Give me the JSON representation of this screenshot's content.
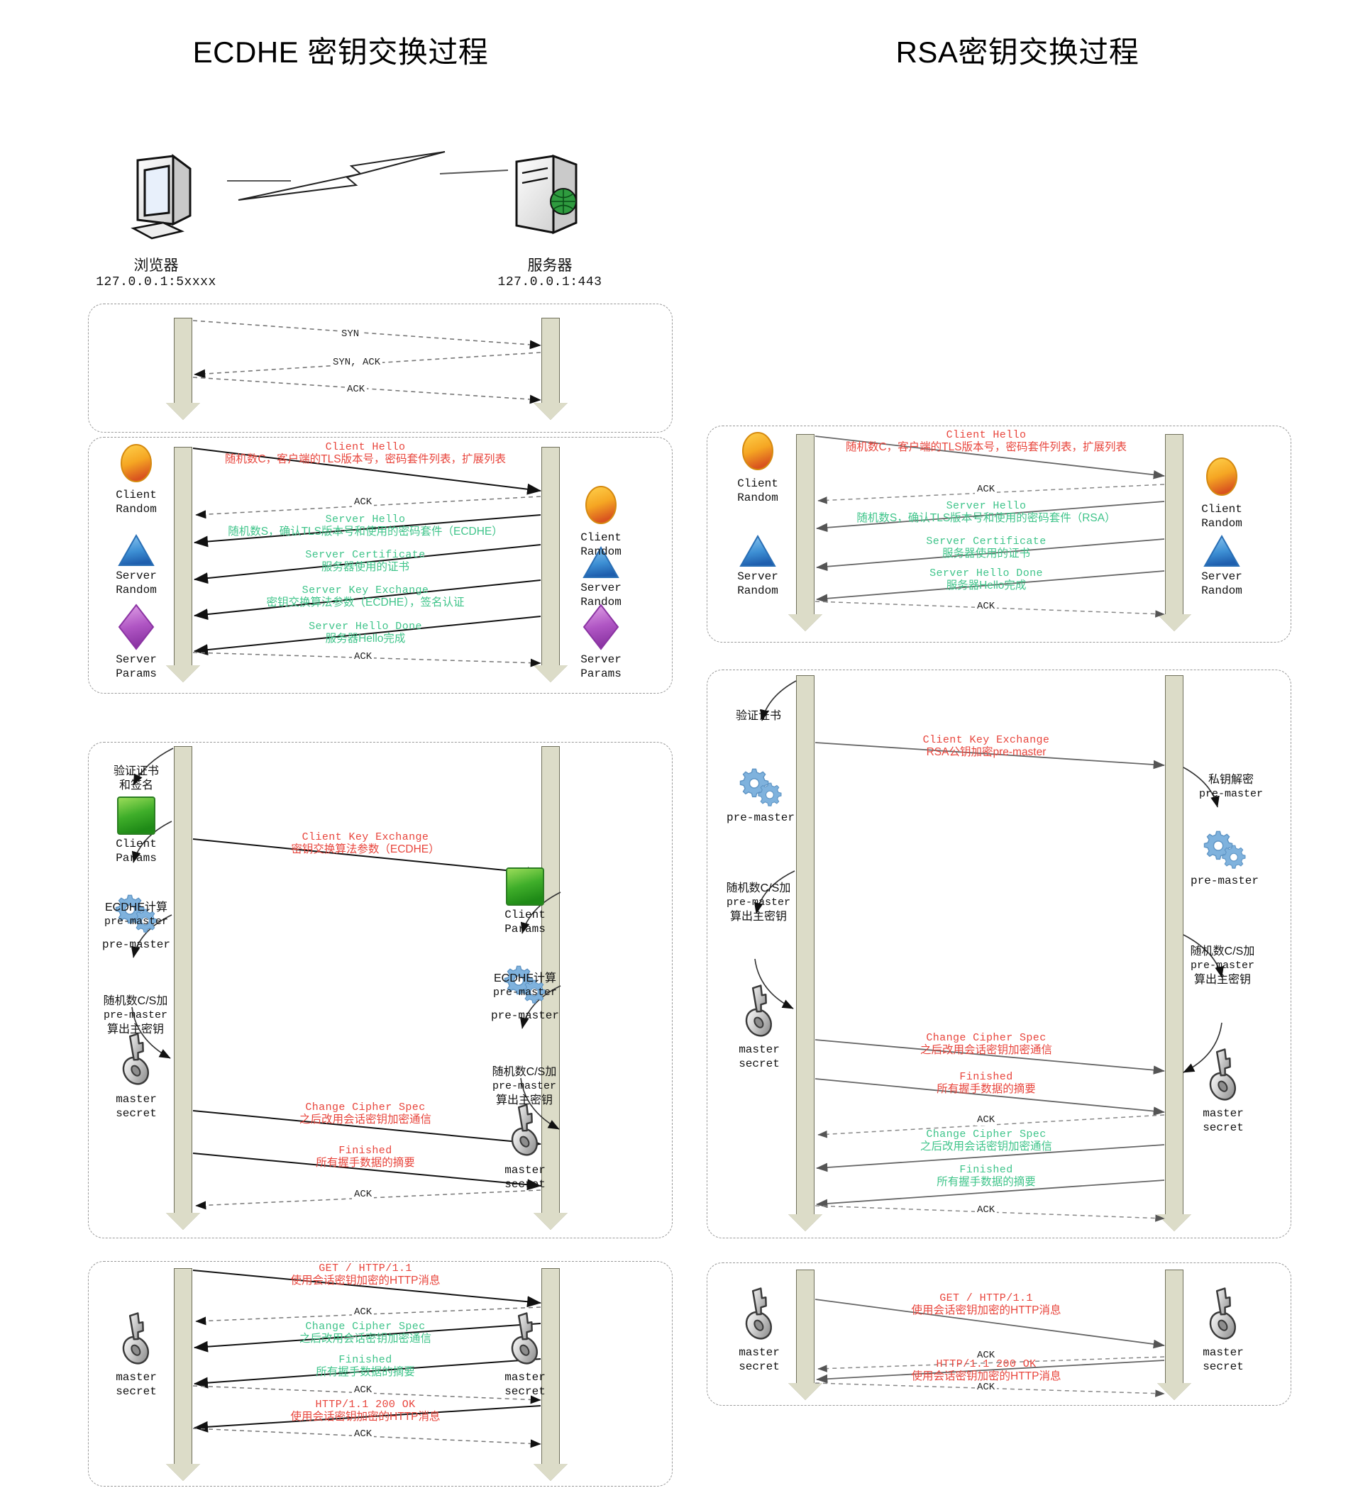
{
  "titles": {
    "ecdhe": "ECDHE 密钥交换过程",
    "rsa": "RSA密钥交换过程"
  },
  "topology": {
    "client": {
      "name": "浏览器",
      "address": "127.0.0.1:5xxxx",
      "icon": "desktop-computer-icon"
    },
    "server": {
      "name": "服务器",
      "address": "127.0.0.1:443",
      "icon": "server-rack-icon"
    },
    "link_icon": "lightning-link-icon"
  },
  "ecdhe": {
    "tcp": {
      "messages": [
        {
          "label": "SYN",
          "dir": "right",
          "style": "dashed"
        },
        {
          "label": "SYN, ACK",
          "dir": "left",
          "style": "dashed"
        },
        {
          "label": "ACK",
          "dir": "right",
          "style": "dashed"
        }
      ]
    },
    "hello": {
      "client_icons": [
        {
          "icon": "orange-ellipse-icon",
          "label_1": "Client",
          "label_2": "Random"
        },
        {
          "icon": "blue-triangle-icon",
          "label_1": "Server",
          "label_2": "Random"
        },
        {
          "icon": "purple-diamond-icon",
          "label_1": "Server",
          "label_2": "Params"
        }
      ],
      "server_icons": [
        {
          "icon": "orange-ellipse-icon",
          "label_1": "Client",
          "label_2": "Random"
        },
        {
          "icon": "blue-triangle-icon",
          "label_1": "Server",
          "label_2": "Random"
        },
        {
          "icon": "purple-diamond-icon",
          "label_1": "Server",
          "label_2": "Params"
        }
      ],
      "messages": [
        {
          "en": "Client Hello",
          "zh": "随机数C，客户端的TLS版本号，密码套件列表，扩展列表",
          "color": "red",
          "dir": "right"
        },
        {
          "en": "ACK",
          "zh": "",
          "color": "black",
          "dir": "left",
          "style": "dashed"
        },
        {
          "en": "Server Hello",
          "zh": "随机数S，确认TLS版本号和使用的密码套件（ECDHE）",
          "color": "green",
          "dir": "left"
        },
        {
          "en": "Server Certificate",
          "zh": "服务器使用的证书",
          "color": "green",
          "dir": "left"
        },
        {
          "en": "Server Key Exchange",
          "zh": "密钥交换算法参数（ECDHE），签名认证",
          "color": "green",
          "dir": "left"
        },
        {
          "en": "Server Hello Done",
          "zh": "服务器Hello完成",
          "color": "green",
          "dir": "left"
        },
        {
          "en": "ACK",
          "zh": "",
          "color": "black",
          "dir": "right",
          "style": "dashed"
        }
      ]
    },
    "keyexchange": {
      "client_notes": [
        {
          "text_1": "验证证书",
          "text_2": "和签名"
        },
        {
          "icon": "green-square-icon",
          "label_1": "Client",
          "label_2": "Params"
        },
        {
          "text_1": "ECDHE计算",
          "text_2": "pre-master"
        },
        {
          "icon": "gears-icon",
          "label_1": "pre-master"
        },
        {
          "text_1": "随机数C/S加",
          "text_2": "pre-master",
          "text_3": "算出主密钥"
        },
        {
          "icon": "key-icon",
          "label_1": "master",
          "label_2": "secret"
        }
      ],
      "server_notes": [
        {
          "icon": "green-square-icon",
          "label_1": "Client",
          "label_2": "Params"
        },
        {
          "text_1": "ECDHE计算",
          "text_2": "pre-master"
        },
        {
          "icon": "gears-icon",
          "label_1": "pre-master"
        },
        {
          "text_1": "随机数C/S加",
          "text_2": "pre-master",
          "text_3": "算出主密钥"
        },
        {
          "icon": "key-icon",
          "label_1": "master",
          "label_2": "secret"
        }
      ],
      "messages": [
        {
          "en": "Client Key Exchange",
          "zh": "密钥交换算法参数（ECDHE）",
          "color": "red",
          "dir": "right"
        },
        {
          "en": "Change Cipher Spec",
          "zh": "之后改用会话密钥加密通信",
          "color": "red",
          "dir": "right"
        },
        {
          "en": "Finished",
          "zh": "所有握手数据的摘要",
          "color": "red",
          "dir": "right"
        },
        {
          "en": "ACK",
          "zh": "",
          "color": "black",
          "dir": "left",
          "style": "dashed"
        }
      ]
    },
    "http": {
      "client_icon": {
        "icon": "key-icon",
        "label_1": "master",
        "label_2": "secret"
      },
      "server_icon": {
        "icon": "key-icon",
        "label_1": "master",
        "label_2": "secret"
      },
      "messages": [
        {
          "en": "GET / HTTP/1.1",
          "zh": "使用会话密钥加密的HTTP消息",
          "color": "red",
          "dir": "right"
        },
        {
          "en": "ACK",
          "zh": "",
          "color": "black",
          "dir": "left",
          "style": "dashed"
        },
        {
          "en": "Change Cipher Spec",
          "zh": "之后改用会话密钥加密通信",
          "color": "green",
          "dir": "left"
        },
        {
          "en": "Finished",
          "zh": "所有握手数据的摘要",
          "color": "green",
          "dir": "left"
        },
        {
          "en": "ACK",
          "zh": "",
          "color": "black",
          "dir": "right",
          "style": "dashed"
        },
        {
          "en": "HTTP/1.1 200 OK",
          "zh": "使用会话密钥加密的HTTP消息",
          "color": "red",
          "dir": "left"
        },
        {
          "en": "ACK",
          "zh": "",
          "color": "black",
          "dir": "right",
          "style": "dashed"
        }
      ]
    }
  },
  "rsa": {
    "hello": {
      "client_icons": [
        {
          "icon": "orange-ellipse-icon",
          "label_1": "Client",
          "label_2": "Random"
        },
        {
          "icon": "blue-triangle-icon",
          "label_1": "Server",
          "label_2": "Random"
        }
      ],
      "server_icons": [
        {
          "icon": "orange-ellipse-icon",
          "label_1": "Client",
          "label_2": "Random"
        },
        {
          "icon": "blue-triangle-icon",
          "label_1": "Server",
          "label_2": "Random"
        }
      ],
      "messages": [
        {
          "en": "Client Hello",
          "zh": "随机数C，客户端的TLS版本号，密码套件列表，扩展列表",
          "color": "red",
          "dir": "right"
        },
        {
          "en": "ACK",
          "zh": "",
          "color": "black",
          "dir": "left",
          "style": "dashed"
        },
        {
          "en": "Server Hello",
          "zh": "随机数S，确认TLS版本号和使用的密码套件（RSA）",
          "color": "green",
          "dir": "left"
        },
        {
          "en": "Server Certificate",
          "zh": "服务器使用的证书",
          "color": "green",
          "dir": "left"
        },
        {
          "en": "Server Hello Done",
          "zh": "服务器Hello完成",
          "color": "green",
          "dir": "left"
        },
        {
          "en": "ACK",
          "zh": "",
          "color": "black",
          "dir": "right",
          "style": "dashed"
        }
      ]
    },
    "keyexchange": {
      "client_notes": [
        {
          "text_1": "验证证书"
        },
        {
          "icon": "gears-icon",
          "label_1": "pre-master"
        },
        {
          "text_1": "随机数C/S加",
          "text_2": "pre-master",
          "text_3": "算出主密钥"
        },
        {
          "icon": "key-icon",
          "label_1": "master",
          "label_2": "secret"
        }
      ],
      "server_notes": [
        {
          "text_1": "私钥解密",
          "text_2": "pre-master"
        },
        {
          "icon": "gears-icon",
          "label_1": "pre-master"
        },
        {
          "text_1": "随机数C/S加",
          "text_2": "pre-master",
          "text_3": "算出主密钥"
        },
        {
          "icon": "key-icon",
          "label_1": "master",
          "label_2": "secret"
        }
      ],
      "messages": [
        {
          "en": "Client Key Exchange",
          "zh": "RSA公钥加密pre-master",
          "color": "red",
          "dir": "right"
        },
        {
          "en": "Change Cipher Spec",
          "zh": "之后改用会话密钥加密通信",
          "color": "red",
          "dir": "right"
        },
        {
          "en": "Finished",
          "zh": "所有握手数据的摘要",
          "color": "red",
          "dir": "right"
        },
        {
          "en": "ACK",
          "zh": "",
          "color": "black",
          "dir": "left",
          "style": "dashed"
        },
        {
          "en": "Change Cipher Spec",
          "zh": "之后改用会话密钥加密通信",
          "color": "green",
          "dir": "left"
        },
        {
          "en": "Finished",
          "zh": "所有握手数据的摘要",
          "color": "green",
          "dir": "left"
        },
        {
          "en": "ACK",
          "zh": "",
          "color": "black",
          "dir": "right",
          "style": "dashed"
        }
      ]
    },
    "http": {
      "client_icon": {
        "icon": "key-icon",
        "label_1": "master",
        "label_2": "secret"
      },
      "server_icon": {
        "icon": "key-icon",
        "label_1": "master",
        "label_2": "secret"
      },
      "messages": [
        {
          "en": "GET / HTTP/1.1",
          "zh": "使用会话密钥加密的HTTP消息",
          "color": "red",
          "dir": "right"
        },
        {
          "en": "ACK",
          "zh": "",
          "color": "black",
          "dir": "left",
          "style": "dashed"
        },
        {
          "en": "HTTP/1.1 200 OK",
          "zh": "使用会话密钥加密的HTTP消息",
          "color": "red",
          "dir": "left"
        },
        {
          "en": "ACK",
          "zh": "",
          "color": "black",
          "dir": "right",
          "style": "dashed"
        }
      ]
    }
  },
  "colors": {
    "client_msg": "#e8453c",
    "server_msg": "#3fc48a",
    "ack": "#1a1a1a",
    "pillar": "#dcdcc8",
    "pillar_border": "#6f6f5a",
    "phase_border": "#9a9a9a"
  }
}
